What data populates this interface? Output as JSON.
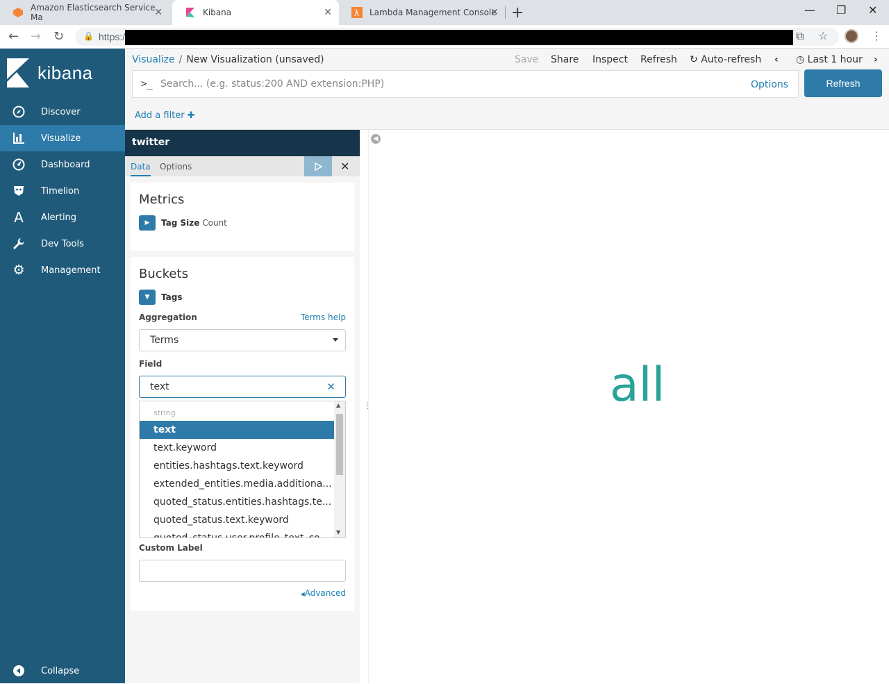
{
  "browser": {
    "tabs": [
      {
        "title": "Amazon Elasticsearch Service Ma",
        "active": false
      },
      {
        "title": "Kibana",
        "active": true
      },
      {
        "title": "Lambda Management Console",
        "active": false
      }
    ],
    "url": "https:/"
  },
  "sidebar": {
    "logo": "kibana",
    "items": [
      {
        "label": "Discover",
        "icon": "compass-icon"
      },
      {
        "label": "Visualize",
        "icon": "bar-chart-icon"
      },
      {
        "label": "Dashboard",
        "icon": "dashboard-icon"
      },
      {
        "label": "Timelion",
        "icon": "timelion-icon"
      },
      {
        "label": "Alerting",
        "icon": "alerting-icon"
      },
      {
        "label": "Dev Tools",
        "icon": "wrench-icon"
      },
      {
        "label": "Management",
        "icon": "gear-icon"
      }
    ],
    "collapse": "Collapse"
  },
  "header": {
    "breadcrumb_link": "Visualize",
    "breadcrumb_sep": "/",
    "breadcrumb_current": "New Visualization (unsaved)",
    "save": "Save",
    "share": "Share",
    "inspect": "Inspect",
    "refresh": "Refresh",
    "auto_refresh": "Auto-refresh",
    "time": "Last 1 hour"
  },
  "search": {
    "prompt": ">_",
    "placeholder": "Search... (e.g. status:200 AND extension:PHP)",
    "options": "Options",
    "refresh_button": "Refresh"
  },
  "filters": {
    "add": "Add a filter"
  },
  "editor": {
    "index": "twitter",
    "tabs": [
      "Data",
      "Options"
    ],
    "metrics": {
      "title": "Metrics",
      "agg_name": "Tag Size",
      "agg_type": "Count"
    },
    "buckets": {
      "title": "Buckets",
      "agg_name": "Tags",
      "aggregation_label": "Aggregation",
      "terms_help": "Terms help",
      "aggregation_value": "Terms",
      "field_label": "Field",
      "field_value": "text",
      "dropdown_group": "string",
      "dropdown_items": [
        "text",
        "text.keyword",
        "entities.hashtags.text.keyword",
        "extended_entities.media.additiona...",
        "quoted_status.entities.hashtags.te...",
        "quoted_status.text.keyword",
        "quoted_status.user.profile_text_co..."
      ],
      "custom_label": "Custom Label",
      "advanced": "Advanced"
    }
  },
  "visualization": {
    "metric_value": "all"
  }
}
